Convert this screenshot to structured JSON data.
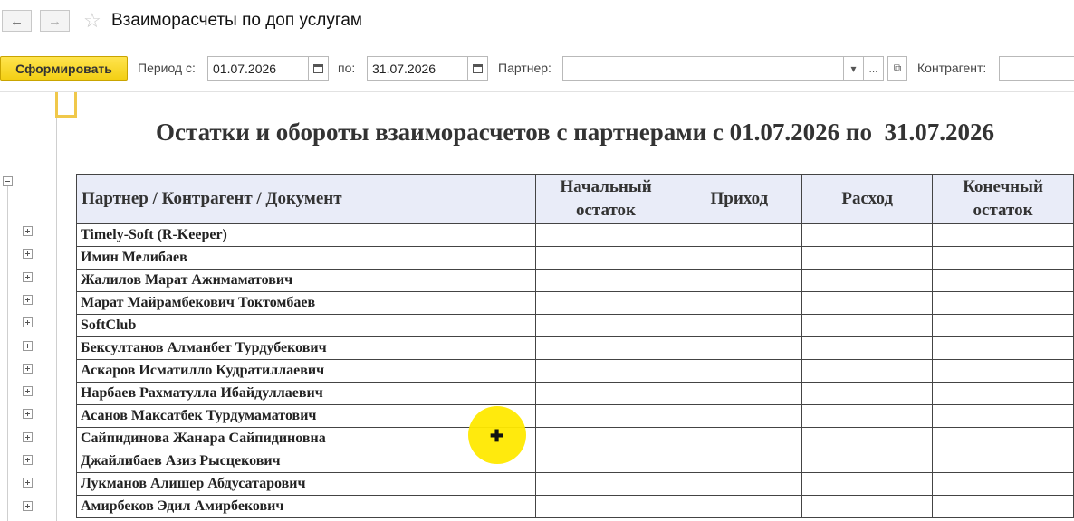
{
  "window": {
    "title": "Взаиморасчеты по доп услугам",
    "nav_back": "←",
    "nav_forward": "→",
    "star": "☆"
  },
  "toolbar": {
    "generate_label": "Сформировать",
    "period_from_label": "Период с:",
    "period_from_value": "01.07.2026",
    "period_to_label": "по:",
    "period_to_value": "31.07.2026",
    "partner_label": "Партнер:",
    "partner_value": "",
    "partner_dropdown": "▾",
    "partner_more": "...",
    "partner_open": "⧉",
    "counterparty_label": "Контрагент:",
    "counterparty_value": ""
  },
  "report": {
    "title": "Остатки и обороты взаиморасчетов с партнерами с 01.07.2026 по  31.07.2026",
    "columns": {
      "name": "Партнер / Контрагент / Документ",
      "opening_1": "Начальный",
      "opening_2": "остаток",
      "income": "Приход",
      "expense": "Расход",
      "closing_1": "Конечный",
      "closing_2": "остаток"
    },
    "rows": [
      "Timely-Soft (R-Keeper)",
      "Имин Мелибаев",
      "Жалилов Марат Ажимаматович",
      "Марат Майрамбекович Токтомбаев",
      "SoftClub",
      "Бексултанов Алманбет Турдубекович",
      "Аскаров Исматилло Кудратиллаевич",
      "Нарбаев Рахматулла Ибайдуллаевич",
      "Асанов Максатбек Турдумаматович",
      "Сайпидинова Жанара Сайпидиновна",
      "Джайлибаев Азиз Рысцекович",
      "Лукманов Алишер Абдусатарович",
      "Амирбеков Эдил Амирбекович"
    ]
  },
  "cursor": {
    "glyph": "✚"
  }
}
